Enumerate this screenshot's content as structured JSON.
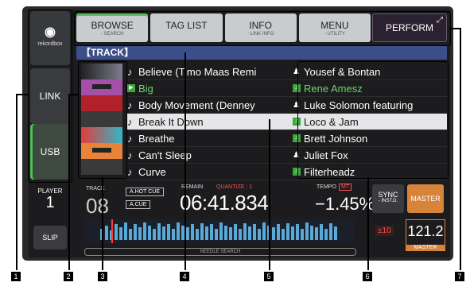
{
  "sidebar": {
    "logo_label": "rekordbox",
    "link_label": "LINK",
    "usb_label": "USB",
    "player_label": "PLAYER",
    "player_number": "1",
    "slip_label": "SLIP"
  },
  "tabs": [
    {
      "label": "BROWSE",
      "sub": "- SEARCH"
    },
    {
      "label": "TAG LIST",
      "sub": ""
    },
    {
      "label": "INFO",
      "sub": "- LINK INFO"
    },
    {
      "label": "MENU",
      "sub": "- UTILITY"
    }
  ],
  "perform_label": "PERFORM",
  "list_header": "【TRACK】",
  "tracks": [
    {
      "title": "Believe (Timo Maas Remi",
      "artist": "Yousef & Bontan",
      "title_icon": "note",
      "artist_icon": "person"
    },
    {
      "title": "Big",
      "artist": "Rene Amesz",
      "title_icon": "play",
      "artist_icon": "playlist"
    },
    {
      "title": "Body Movement (Denney",
      "artist": "Luke Solomon featuring",
      "title_icon": "note",
      "artist_icon": "person"
    },
    {
      "title": "Break It Down",
      "artist": "Loco & Jam",
      "title_icon": "note",
      "artist_icon": "playlist"
    },
    {
      "title": "Breathe",
      "artist": "Brett Johnson",
      "title_icon": "note",
      "artist_icon": "playlist"
    },
    {
      "title": "Can't Sleep",
      "artist": "Juliet Fox",
      "title_icon": "note",
      "artist_icon": "person"
    },
    {
      "title": "Curve",
      "artist": "Filterheadz",
      "title_icon": "note",
      "artist_icon": "playlist"
    }
  ],
  "performance": {
    "track_label": "TRACK",
    "track_number": "08",
    "hot_cue_label": "A.HOT CUE",
    "auto_cue_label": "A.CUE",
    "remain_label": "REMAIN",
    "quantize_label": "QUANTIZE : 1",
    "time": "06:41.834",
    "tempo_label": "TEMPO",
    "tempo_range_tag": "MT",
    "tempo_value": "−1.45%",
    "sync_label": "SYNC",
    "sync_sub": "- INST.D.",
    "master_label": "MASTER",
    "range_label": "±10",
    "bpm_value": "121.2",
    "bpm_master_label": "MASTER",
    "needle_search_label": "NEEDLE SEARCH"
  },
  "callout_numbers": [
    "1",
    "2",
    "3",
    "4",
    "5",
    "6",
    "7"
  ],
  "colors": {
    "accent_green": "#56c156",
    "master_orange": "#d7843a",
    "header_blue": "#3c4f8a"
  }
}
